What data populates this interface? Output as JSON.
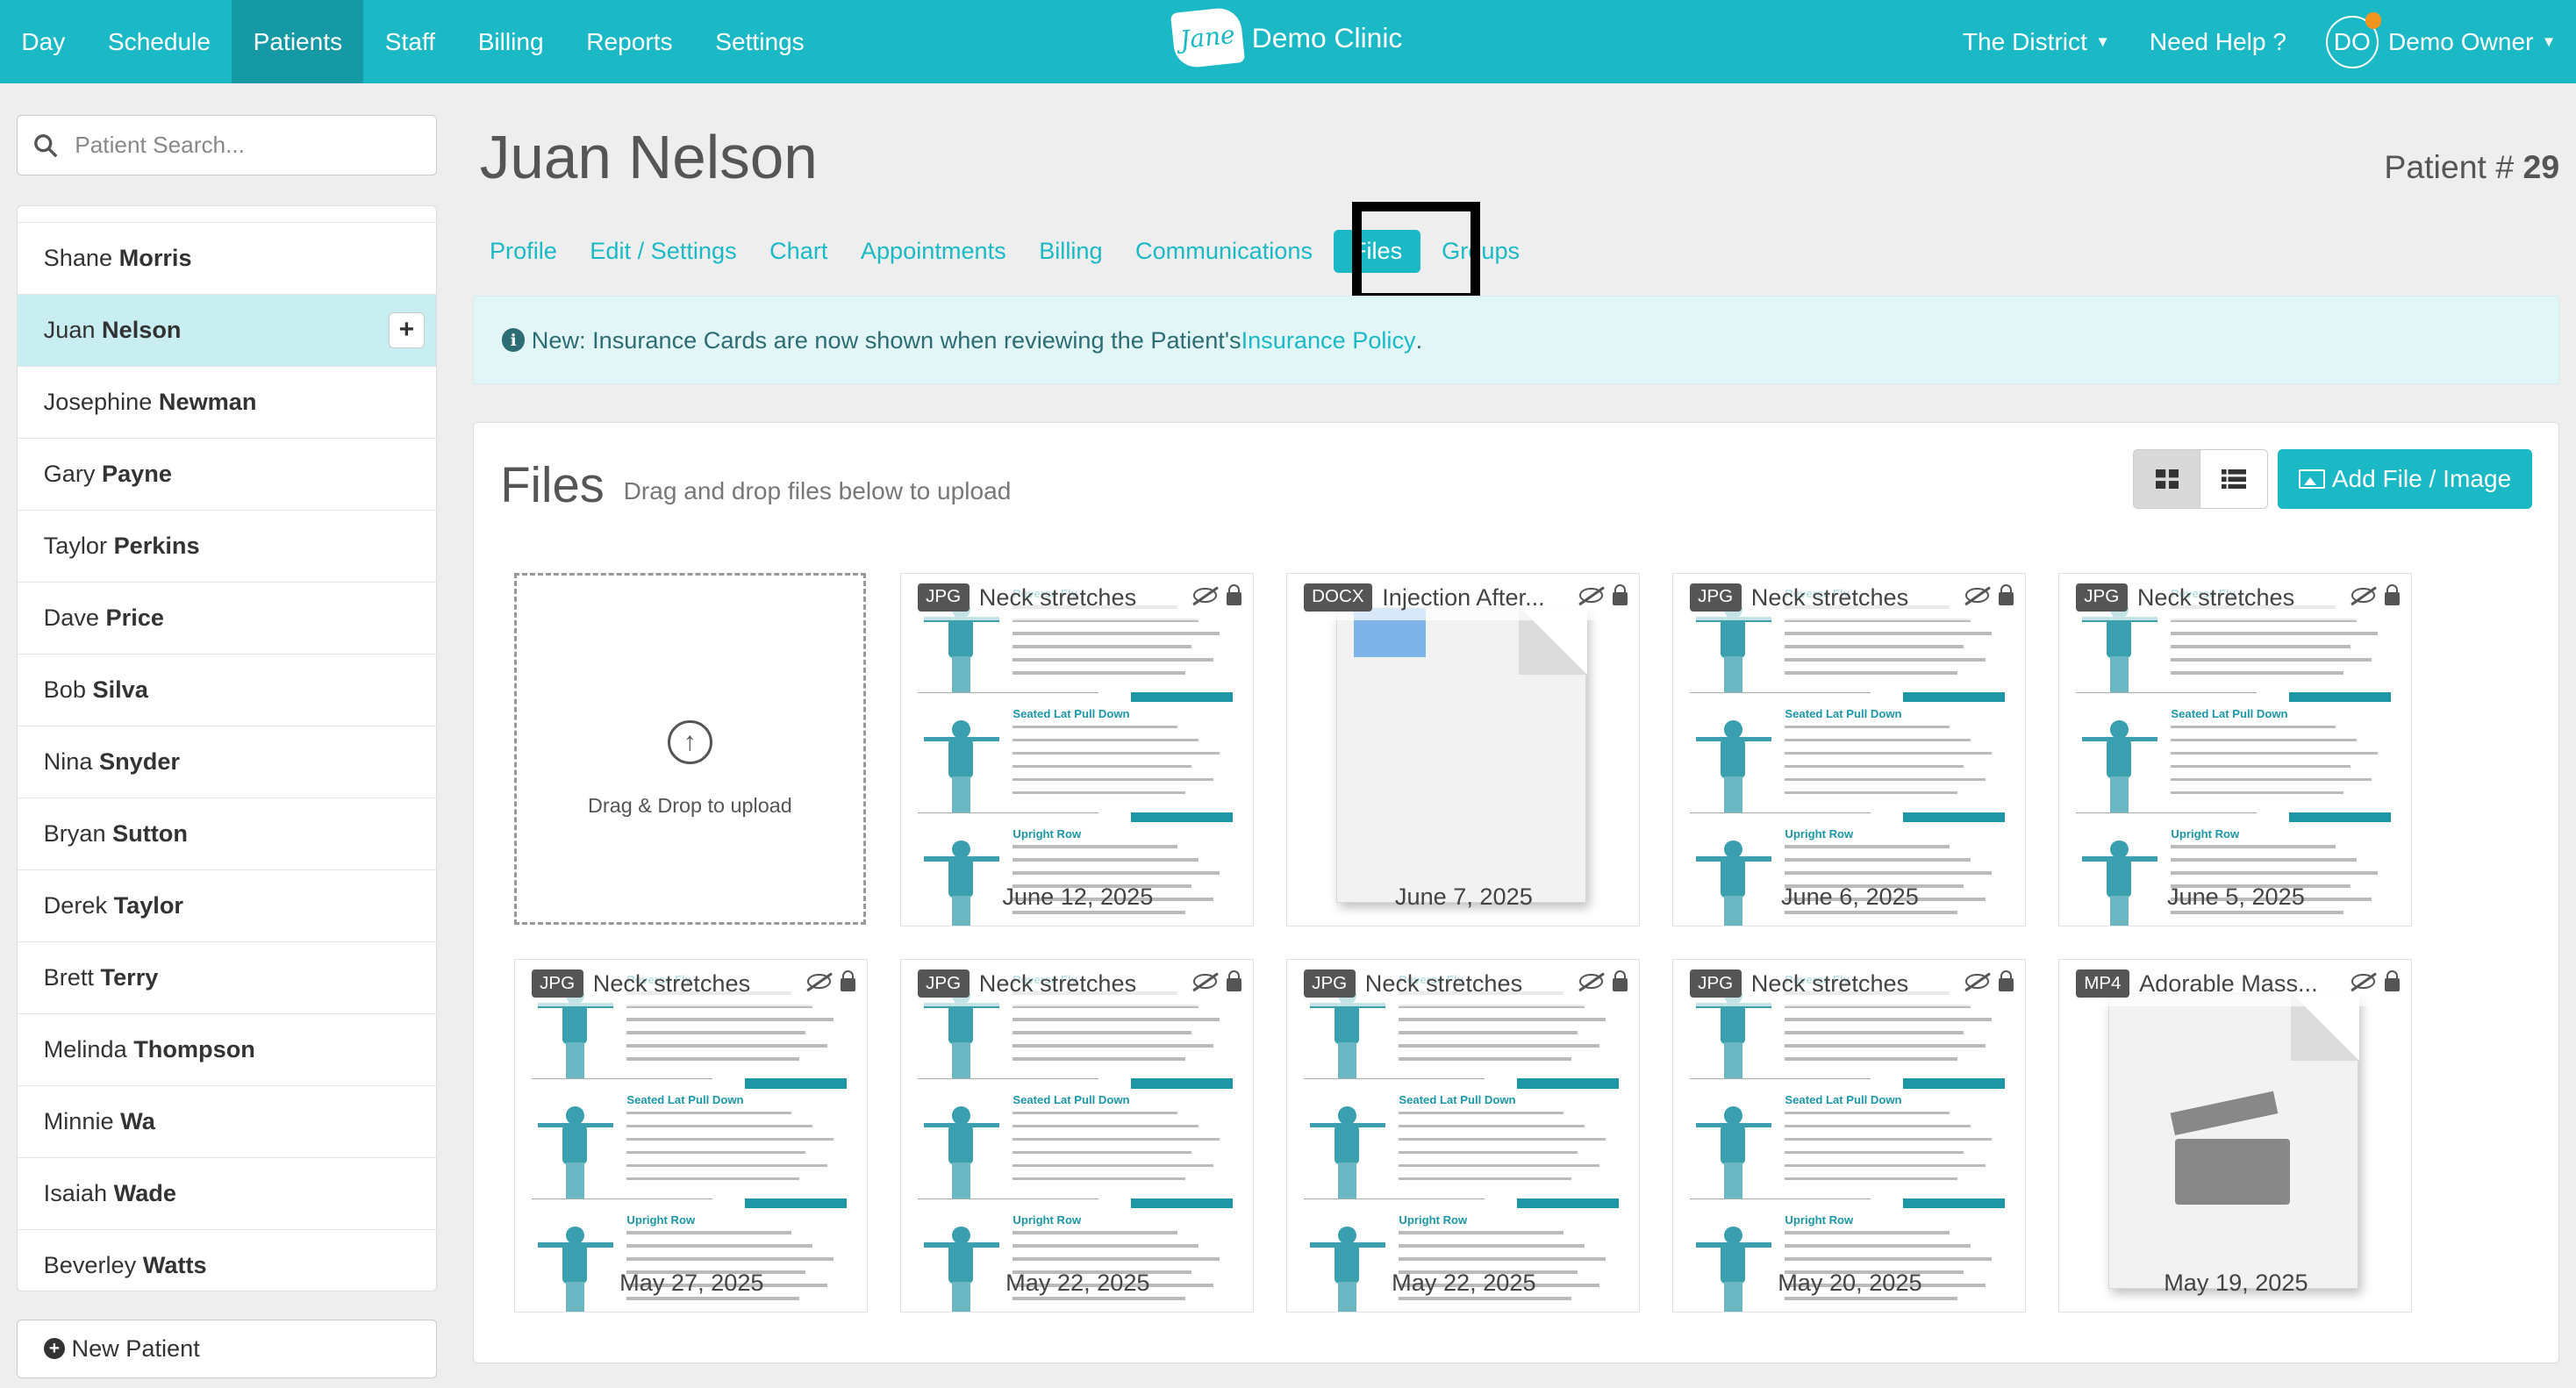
{
  "nav": {
    "left": [
      "Day",
      "Schedule",
      "Patients",
      "Staff",
      "Billing",
      "Reports",
      "Settings"
    ],
    "active": "Patients",
    "brand_logo": "Jane",
    "clinic": "Demo Clinic",
    "location": "The District",
    "help": "Need Help ?",
    "avatar_initials": "DO",
    "user": "Demo Owner",
    "colors": {
      "primary": "#1ab9c5",
      "active": "#159aa5",
      "notification": "#f7941d"
    }
  },
  "sidebar": {
    "search_placeholder": "Patient Search...",
    "patients": [
      {
        "first": "Shane",
        "last": "Morris"
      },
      {
        "first": "Juan",
        "last": "Nelson",
        "selected": true
      },
      {
        "first": "Josephine",
        "last": "Newman"
      },
      {
        "first": "Gary",
        "last": "Payne"
      },
      {
        "first": "Taylor",
        "last": "Perkins"
      },
      {
        "first": "Dave",
        "last": "Price"
      },
      {
        "first": "Bob",
        "last": "Silva"
      },
      {
        "first": "Nina",
        "last": "Snyder"
      },
      {
        "first": "Bryan",
        "last": "Sutton"
      },
      {
        "first": "Derek",
        "last": "Taylor"
      },
      {
        "first": "Brett",
        "last": "Terry"
      },
      {
        "first": "Melinda",
        "last": "Thompson"
      },
      {
        "first": "Minnie",
        "last": "Wa"
      },
      {
        "first": "Isaiah",
        "last": "Wade"
      },
      {
        "first": "Beverley",
        "last": "Watts"
      }
    ],
    "add_icon": "+",
    "new_patient": "New Patient"
  },
  "patient": {
    "name": "Juan Nelson",
    "number_label": "Patient #",
    "number": "29"
  },
  "tabs": [
    "Profile",
    "Edit / Settings",
    "Chart",
    "Appointments",
    "Billing",
    "Communications",
    "Files",
    "Groups"
  ],
  "active_tab": "Files",
  "notice": {
    "icon": "i",
    "text": "New: Insurance Cards are now shown when reviewing the Patient's ",
    "link": "Insurance Policy",
    "end": "."
  },
  "files": {
    "title": "Files",
    "subtitle": "Drag and drop files below to upload",
    "add_button": "Add File / Image",
    "dropzone_text": "Drag & Drop to upload",
    "worksheet": {
      "exercises": [
        "Reverse Fly",
        "Seated Lat Pull Down",
        "Upright Row"
      ]
    },
    "items": [
      {
        "type": "JPG",
        "name": "Neck stretches",
        "date": "June 12, 2025",
        "thumb": "worksheet"
      },
      {
        "type": "DOCX",
        "name": "Injection After...",
        "date": "June 7, 2025",
        "thumb": "doc"
      },
      {
        "type": "JPG",
        "name": "Neck stretches",
        "date": "June 6, 2025",
        "thumb": "worksheet"
      },
      {
        "type": "JPG",
        "name": "Neck stretches",
        "date": "June 5, 2025",
        "thumb": "worksheet"
      },
      {
        "type": "JPG",
        "name": "Neck stretches",
        "date": "May 27, 2025",
        "thumb": "worksheet"
      },
      {
        "type": "JPG",
        "name": "Neck stretches",
        "date": "May 22, 2025",
        "thumb": "worksheet"
      },
      {
        "type": "JPG",
        "name": "Neck stretches",
        "date": "May 22, 2025",
        "thumb": "worksheet"
      },
      {
        "type": "JPG",
        "name": "Neck stretches",
        "date": "May 20, 2025",
        "thumb": "worksheet"
      },
      {
        "type": "MP4",
        "name": "Adorable Mass...",
        "date": "May 19, 2025",
        "thumb": "video"
      }
    ]
  }
}
